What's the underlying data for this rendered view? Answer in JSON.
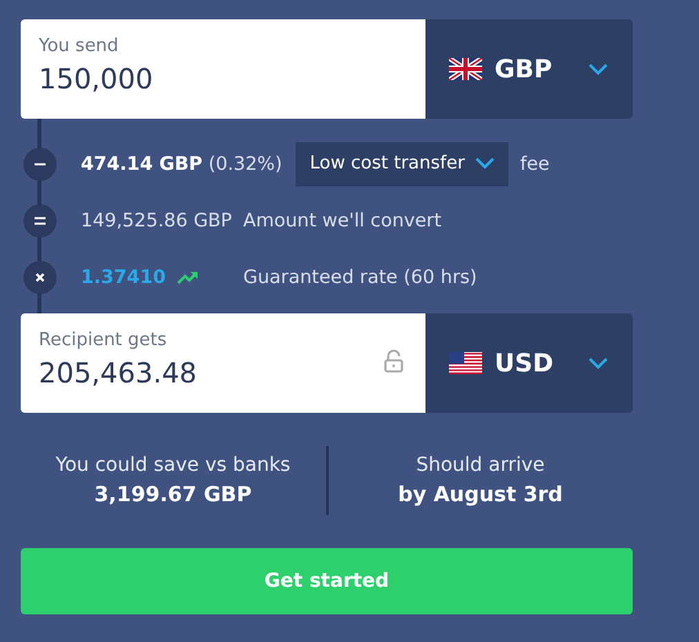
{
  "amounts": [
    {
      "label": "You send",
      "value": "150,000",
      "currency": "GBP"
    },
    {
      "label": "Recipient gets",
      "value": "205,463.48",
      "currency": "USD",
      "locked": false
    }
  ],
  "breakdown": [
    {
      "kind": "fee",
      "amount": "**474.14 GBP** (0.32%)",
      "option": "Low cost transfer",
      "suffix": "fee"
    },
    {
      "kind": "convert",
      "amount": "149,525.86 GBP",
      "text": "Amount we'll convert"
    },
    {
      "kind": "rate",
      "amount": "1.37410",
      "text": "Guaranteed rate (60 hrs)"
    }
  ],
  "stats": [
    {
      "label": "You could save vs banks",
      "value": "3,199.67 GBP"
    },
    {
      "label": "Should arrive",
      "value": "by August 3rd"
    }
  ],
  "button": "Get started"
}
